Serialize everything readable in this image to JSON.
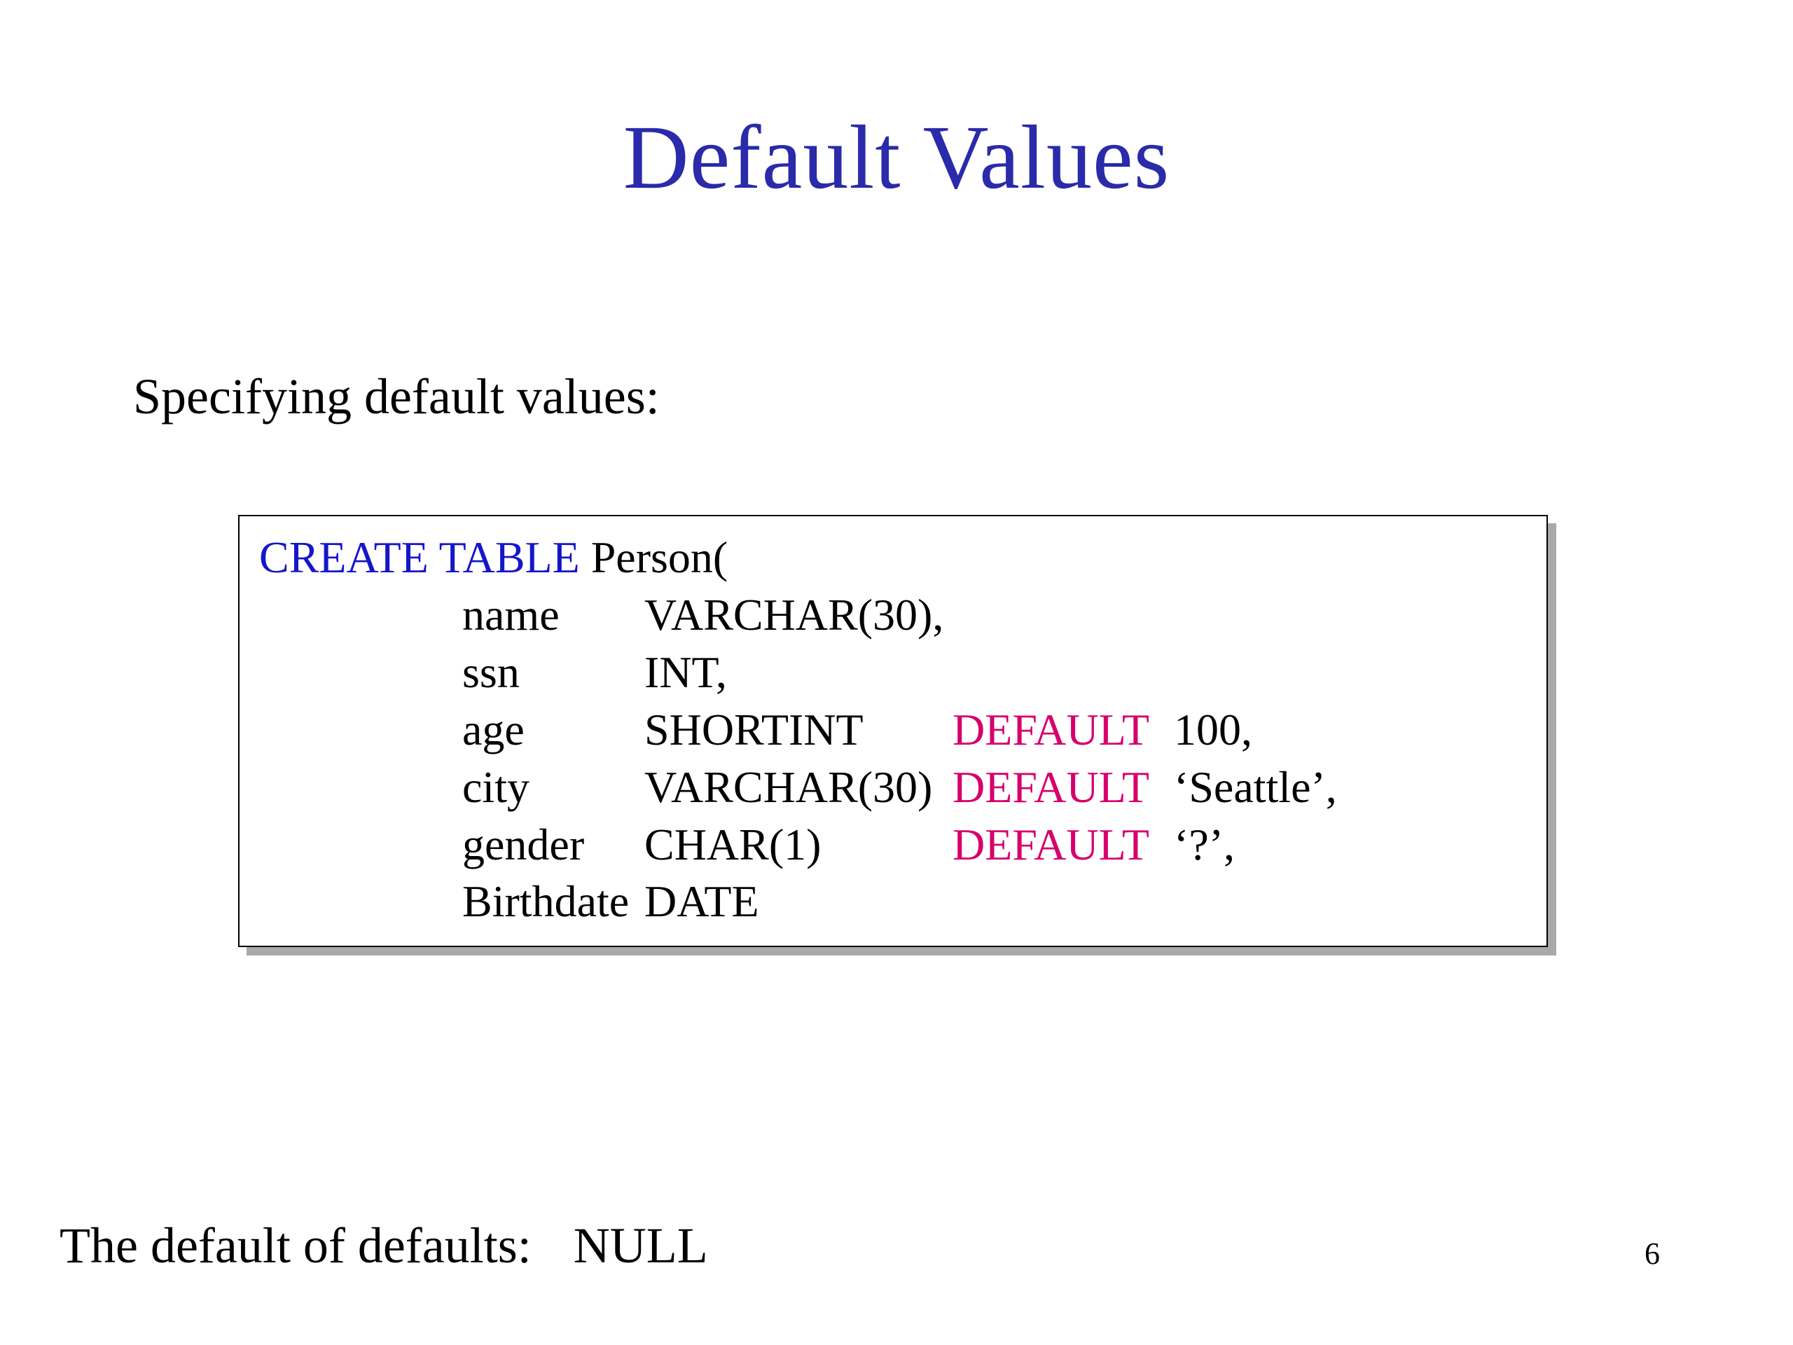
{
  "title": "Default Values",
  "subheading": "Specifying default values:",
  "sql": {
    "create_kw": "CREATE  TABLE",
    "table_name": " Person(",
    "rows": [
      {
        "name": "name",
        "type": "VARCHAR(30),",
        "default_kw": "",
        "default_val": ""
      },
      {
        "name": "ssn",
        "type": "INT,",
        "default_kw": "",
        "default_val": ""
      },
      {
        "name": "age",
        "type": "SHORTINT",
        "default_kw": "DEFAULT",
        "default_val": " 100,"
      },
      {
        "name": "city",
        "type": "VARCHAR(30)",
        "default_kw": "DEFAULT",
        "default_val": "  ‘Seattle’,"
      },
      {
        "name": "gender",
        "type": "CHAR(1)",
        "default_kw": "DEFAULT",
        "default_val": "  ‘?’,"
      },
      {
        "name": "Birthdate",
        "type": "DATE",
        "default_kw": "",
        "default_val": ""
      }
    ]
  },
  "footer_label": "The default of defaults:",
  "footer_value": "NULL",
  "page_number": "6"
}
